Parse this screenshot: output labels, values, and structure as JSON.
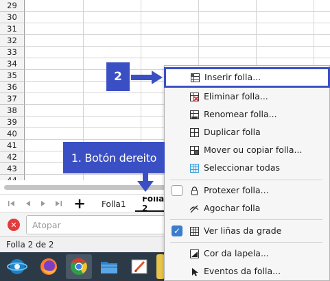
{
  "grid": {
    "row_numbers": [
      "29",
      "30",
      "31",
      "32",
      "33",
      "34",
      "35",
      "36",
      "37",
      "38",
      "39",
      "40",
      "41",
      "42",
      "43",
      "44"
    ]
  },
  "tabbar": {
    "nav_first": "⏮",
    "nav_prev": "◀",
    "nav_next": "▶",
    "nav_last": "⏭",
    "add_sheet": "+",
    "tabs": [
      {
        "label": "Folla1",
        "active": false
      },
      {
        "label": "Folla 2",
        "active": true
      }
    ]
  },
  "findbar": {
    "close_label": "✕",
    "placeholder": "Atopar"
  },
  "statusbar": {
    "text": "Folla 2 de 2"
  },
  "taskbar": {
    "apps": [
      "activities-icon",
      "firefox-icon",
      "chrome-icon",
      "files-icon",
      "drawing-icon"
    ]
  },
  "context_menu": {
    "items": [
      {
        "label": "Inserir folla...",
        "icon": "insert-sheet-icon"
      },
      {
        "label": "Eliminar folla...",
        "icon": "delete-sheet-icon"
      },
      {
        "label": "Renomear folla...",
        "icon": "rename-sheet-icon"
      },
      {
        "label": "Duplicar folla",
        "icon": "duplicate-sheet-icon"
      },
      {
        "label": "Mover ou copiar folla...",
        "icon": "move-copy-sheet-icon"
      },
      {
        "label": "Seleccionar todas",
        "icon": "select-all-sheets-icon"
      },
      {
        "label": "Protexer folla...",
        "icon": "lock-icon",
        "checked": false
      },
      {
        "label": "Agochar folla",
        "icon": "hide-sheet-icon"
      },
      {
        "label": "Ver liñas da grade",
        "icon": "grid-lines-icon",
        "checked": true
      },
      {
        "label": "Cor da lapela...",
        "icon": "tab-color-icon"
      },
      {
        "label": "Eventos da folla...",
        "icon": "sheet-events-icon"
      }
    ]
  },
  "annotations": {
    "step1": "1. Botón dereito",
    "step2": "2"
  },
  "colors": {
    "annotation": "#3b4fc4",
    "checkbox_on": "#3d7cc9",
    "close_button": "#e33b3b"
  }
}
